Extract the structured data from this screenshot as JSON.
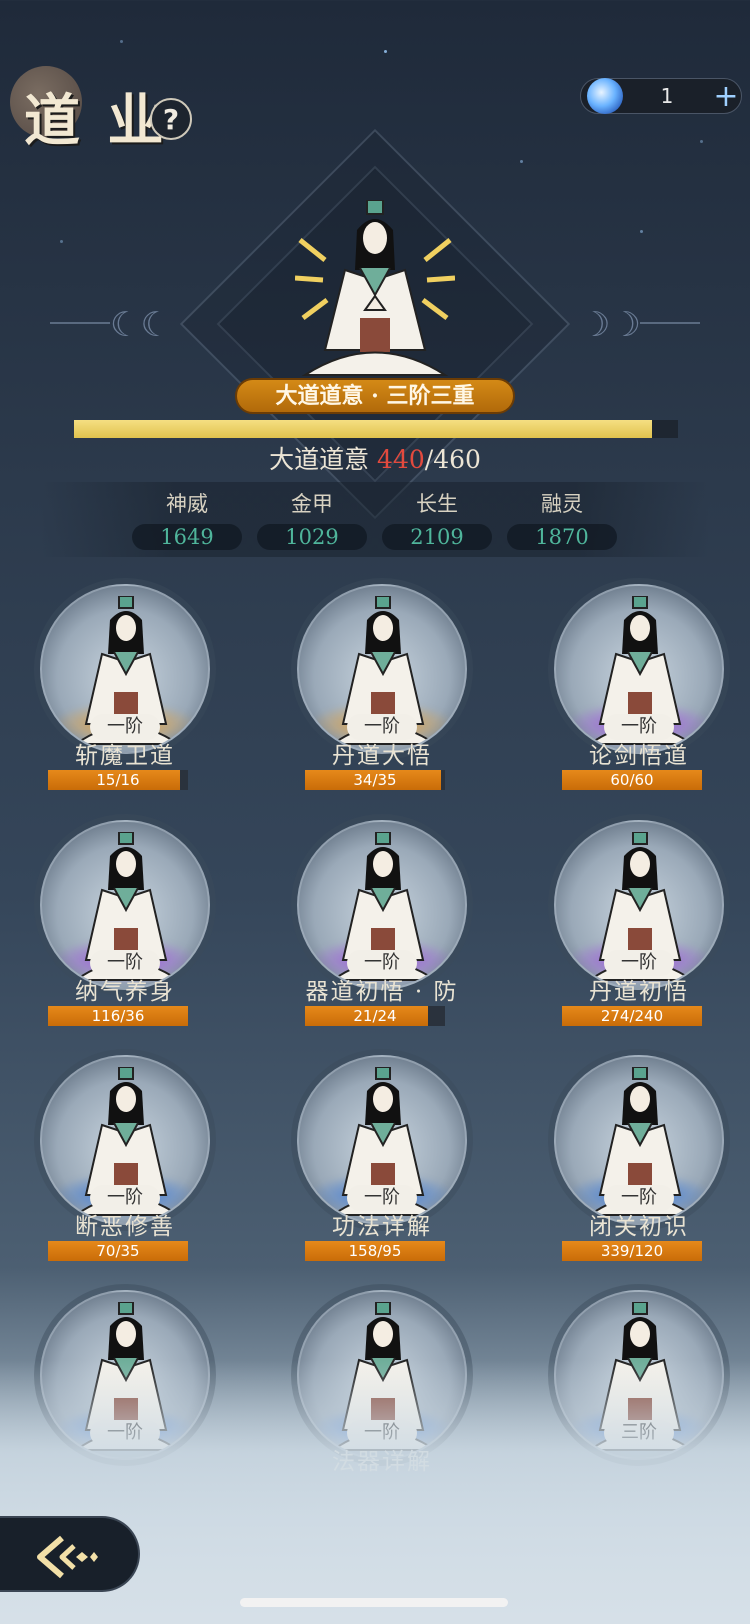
{
  "header": {
    "title": "道 业",
    "help_label": "?"
  },
  "currency": {
    "count": "1",
    "plus_label": "+"
  },
  "hero": {
    "rank_label": "大道道意 · 三阶三重",
    "progress_label": "大道道意",
    "progress_current": "440",
    "progress_max": "/460",
    "progress_fraction": 0.957
  },
  "stats": [
    {
      "label": "神威",
      "value": "1649"
    },
    {
      "label": "金甲",
      "value": "1029"
    },
    {
      "label": "长生",
      "value": "2109"
    },
    {
      "label": "融灵",
      "value": "1870"
    }
  ],
  "skills": [
    {
      "name": "斩魔卫道",
      "tier": "一阶",
      "progress": "15/16",
      "fill": 0.94,
      "glow": "orange"
    },
    {
      "name": "丹道大悟",
      "tier": "一阶",
      "progress": "34/35",
      "fill": 0.97,
      "glow": "orange"
    },
    {
      "name": "论剑悟道",
      "tier": "一阶",
      "progress": "60/60",
      "fill": 1.0,
      "glow": "purple"
    },
    {
      "name": "纳气养身",
      "tier": "一阶",
      "progress": "116/36",
      "fill": 1.0,
      "glow": "purple"
    },
    {
      "name": "器道初悟 · 防",
      "tier": "一阶",
      "progress": "21/24",
      "fill": 0.875,
      "glow": "purple"
    },
    {
      "name": "丹道初悟",
      "tier": "一阶",
      "progress": "274/240",
      "fill": 1.0,
      "glow": "purple"
    },
    {
      "name": "断恶修善",
      "tier": "一阶",
      "progress": "70/35",
      "fill": 1.0,
      "glow": "blue"
    },
    {
      "name": "功法详解",
      "tier": "一阶",
      "progress": "158/95",
      "fill": 1.0,
      "glow": "blue"
    },
    {
      "name": "闭关初识",
      "tier": "一阶",
      "progress": "339/120",
      "fill": 1.0,
      "glow": "blue"
    },
    {
      "name": "",
      "tier": "一阶",
      "progress": "",
      "fill": 0,
      "glow": "blue"
    },
    {
      "name": "法器详解",
      "tier": "一阶",
      "progress": "",
      "fill": 0,
      "glow": "blue"
    },
    {
      "name": "",
      "tier": "三阶",
      "progress": "",
      "fill": 0,
      "glow": "blue"
    }
  ],
  "colors": {
    "accent_gold": "#e0c24e",
    "bar_orange": "#d47a10",
    "stat_value": "#4fb59b",
    "progress_red": "#e24a3e"
  },
  "icons": {
    "currency": "spirit-gem-icon",
    "back": "back-arrow-icon"
  }
}
